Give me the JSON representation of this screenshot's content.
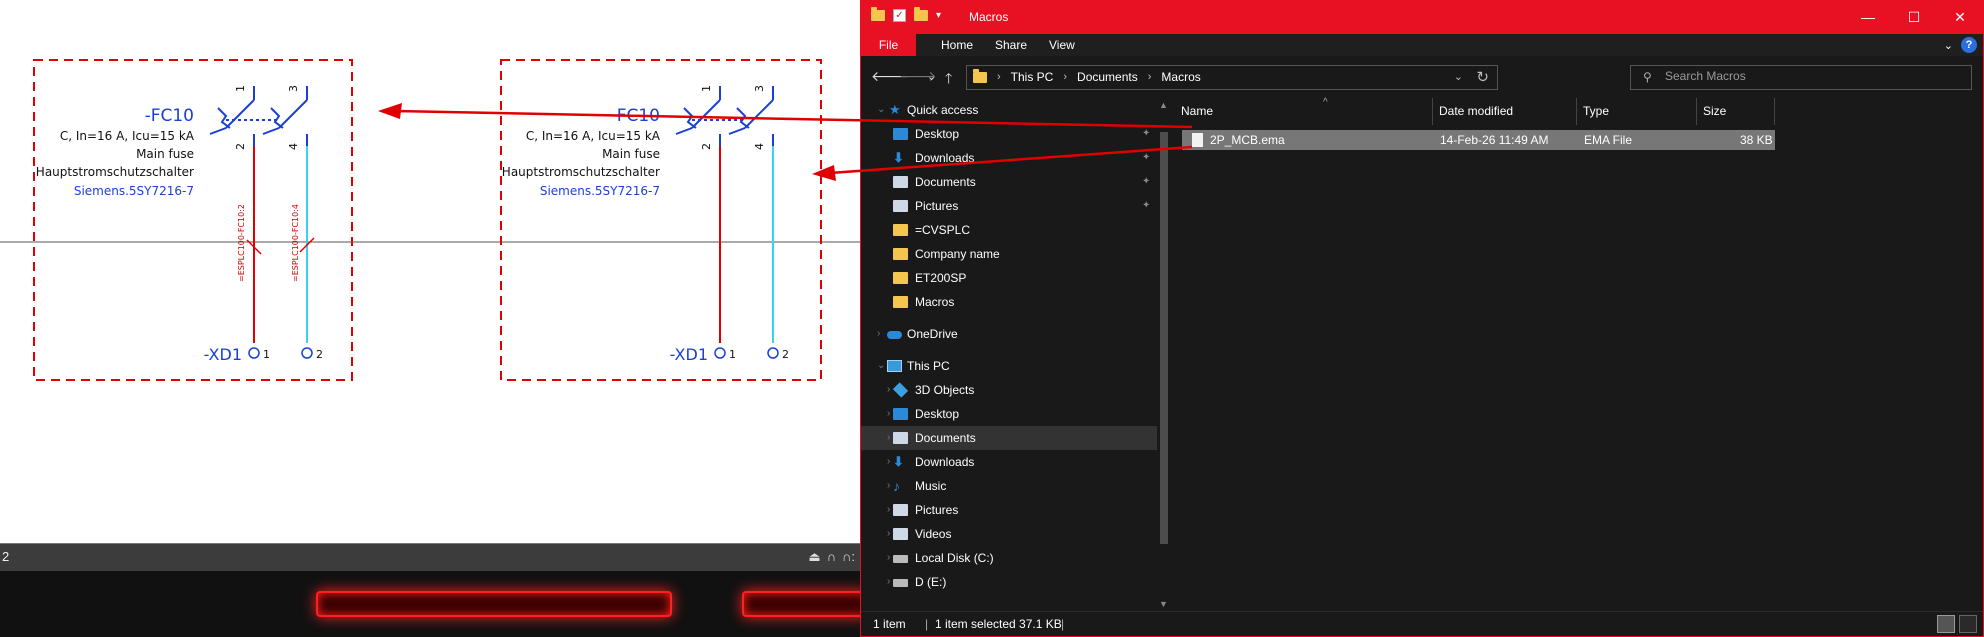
{
  "cad": {
    "left_block": {
      "device_tag": "-FC10",
      "rating": "C, In=16 A, Icu=15 kA",
      "description_en": "Main fuse",
      "description_de": "Hauptstromschutzschalter",
      "part_number": "Siemens.5SY7216-7",
      "pin_1": "1",
      "pin_2": "2",
      "pin_3": "3",
      "pin_4": "4",
      "cable_label_1": "=ESPLC100-FC10:2",
      "cable_label_2": "=ESPLC100-FC10:4",
      "terminal_tag": "-XD1",
      "terminal_1": "1",
      "terminal_2": "2"
    },
    "right_block": {
      "device_tag": "FC10",
      "rating": "C, In=16 A, Icu=15 kA",
      "description_en": "Main fuse",
      "description_de": "Hauptstromschutzschalter",
      "part_number": "Siemens.5SY7216-7",
      "pin_1": "1",
      "pin_2": "2",
      "pin_3": "3",
      "pin_4": "4",
      "terminal_tag": "-XD1",
      "terminal_1": "1",
      "terminal_2": "2"
    },
    "status_left_number": "2",
    "colors": {
      "symbol_blue": "#1a3fd6",
      "wire_red": "#e00000",
      "wire_cyan": "#39d3f0",
      "frame_red": "#e00000"
    }
  },
  "explorer": {
    "title": "Macros",
    "window_buttons": {
      "minimize": "—",
      "maximize": "☐",
      "close": "✕"
    },
    "ribbon": {
      "file": "File",
      "home": "Home",
      "share": "Share",
      "view": "View",
      "help": "?"
    },
    "nav": {
      "back": "🡐",
      "forward": "🡒",
      "recent": "⌄",
      "up": "🡑"
    },
    "address": {
      "root": "This PC",
      "segment1": "Documents",
      "segment2": "Macros"
    },
    "search": {
      "placeholder": "Search Macros"
    },
    "nav_pane": {
      "quick_access": "Quick access",
      "desktop": "Desktop",
      "downloads": "Downloads",
      "documents": "Documents",
      "pictures": "Pictures",
      "cvsplc": "=CVSPLC",
      "company": "Company name",
      "et200sp": "ET200SP",
      "macros": "Macros",
      "onedrive": "OneDrive",
      "this_pc": "This PC",
      "objects3d": "3D Objects",
      "pc_desktop": "Desktop",
      "pc_documents": "Documents",
      "pc_downloads": "Downloads",
      "music": "Music",
      "pc_pictures": "Pictures",
      "videos": "Videos",
      "local_disk": "Local Disk (C:)",
      "d_drive": "D (E:)"
    },
    "columns": {
      "name": "Name",
      "date": "Date modified",
      "type": "Type",
      "size": "Size"
    },
    "file": {
      "name": "2P_MCB.ema",
      "date": "14-Feb-26 11:49 AM",
      "type": "EMA File",
      "size": "38 KB"
    },
    "status": {
      "count": "1 item",
      "selected": "1 item selected  37.1 KB"
    },
    "colors": {
      "accent": "#e81123",
      "background": "#191919",
      "selected_row": "#777777"
    }
  }
}
